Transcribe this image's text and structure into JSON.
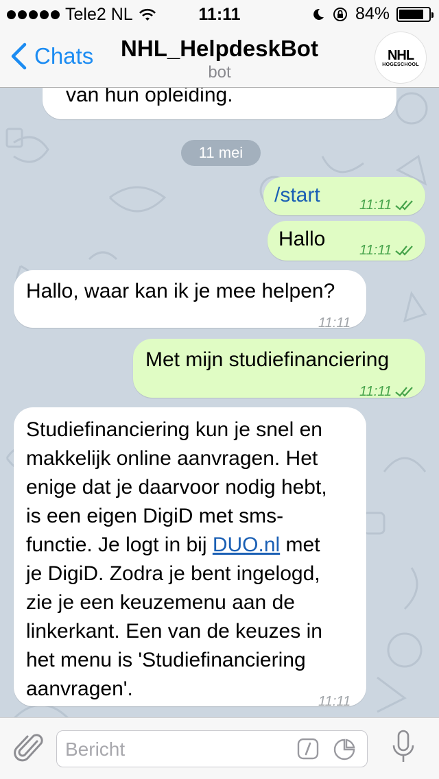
{
  "status_bar": {
    "carrier": "Tele2 NL",
    "time": "11:11",
    "battery_percent": "84%",
    "battery_level": 0.84
  },
  "nav": {
    "back_label": "Chats",
    "title": "NHL_HelpdeskBot",
    "subtitle": "bot",
    "avatar_text": "NHL",
    "avatar_subtext": "HOGESCHOOL"
  },
  "chat": {
    "partial_message": "van hun opleiding.",
    "date_separator": "11 mei",
    "messages": [
      {
        "direction": "out",
        "text": "/start",
        "time": "11:11"
      },
      {
        "direction": "out",
        "text": "Hallo",
        "time": "11:11"
      },
      {
        "direction": "in",
        "text": "Hallo, waar kan ik je mee helpen?",
        "time": "11:11"
      },
      {
        "direction": "out",
        "text": "Met mijn studiefinanciering",
        "time": "11:11"
      },
      {
        "direction": "in",
        "time": "11:11",
        "lines": [
          "Studiefinanciering kun je snel en",
          "makkelijk online aanvragen. Het",
          "enige dat je daarvoor nodig hebt,",
          "is een eigen DigiD met sms-",
          "functie. Je logt in bij",
          "DUO.nl",
          "met",
          "je DigiD. Zodra je bent ingelogd,",
          "zie je een keuzemenu aan de",
          "linkerkant. Een van de keuzes in",
          "het menu is 'Studiefinanciering",
          "aanvragen'."
        ]
      }
    ]
  },
  "input": {
    "placeholder": "Bericht"
  },
  "colors": {
    "accent": "#1c8cf2",
    "outgoing_bubble": "#e0fcc4",
    "incoming_bubble": "#ffffff",
    "chat_background": "#ccd6e0",
    "read_check": "#46a34b"
  }
}
